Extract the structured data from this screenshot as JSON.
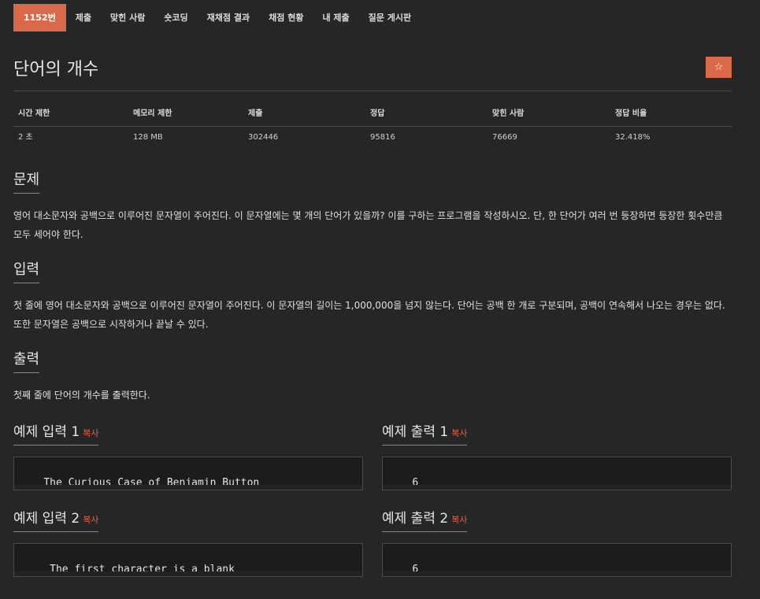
{
  "tabs": [
    {
      "label": "1152번",
      "active": true
    },
    {
      "label": "제출"
    },
    {
      "label": "맞힌 사람"
    },
    {
      "label": "숏코딩"
    },
    {
      "label": "재채점 결과"
    },
    {
      "label": "채점 현황"
    },
    {
      "label": "내 제출"
    },
    {
      "label": "질문 게시판"
    }
  ],
  "problem": {
    "title": "단어의 개수",
    "star": "☆"
  },
  "info": {
    "headers": [
      "시간 제한",
      "메모리 제한",
      "제출",
      "정답",
      "맞힌 사람",
      "정답 비율"
    ],
    "values": [
      "2 초",
      "128 MB",
      "302446",
      "95816",
      "76669",
      "32.418%"
    ]
  },
  "sections": {
    "problem": {
      "heading": "문제",
      "text": "영어 대소문자와 공백으로 이루어진 문자열이 주어진다. 이 문자열에는 몇 개의 단어가 있을까? 이를 구하는 프로그램을 작성하시오. 단, 한 단어가 여러 번 등장하면 등장한 횟수만큼 모두 세어야 한다."
    },
    "input": {
      "heading": "입력",
      "text": "첫 줄에 영어 대소문자와 공백으로 이루어진 문자열이 주어진다. 이 문자열의 길이는 1,000,000을 넘지 않는다. 단어는 공백 한 개로 구분되며, 공백이 연속해서 나오는 경우는 없다. 또한 문자열은 공백으로 시작하거나 끝날 수 있다."
    },
    "output": {
      "heading": "출력",
      "text": "첫째 줄에 단어의 개수를 출력한다."
    }
  },
  "examples": [
    {
      "in_label": "예제 입력 1",
      "out_label": "예제 출력 1",
      "copy": "복사",
      "input": "The Curious Case of Benjamin Button",
      "output": "6"
    },
    {
      "in_label": "예제 입력 2",
      "out_label": "예제 출력 2",
      "copy": "복사",
      "input": " The first character is a blank",
      "output": "6"
    }
  ],
  "colors": {
    "accent": "#d9694a",
    "background": "#262626"
  }
}
